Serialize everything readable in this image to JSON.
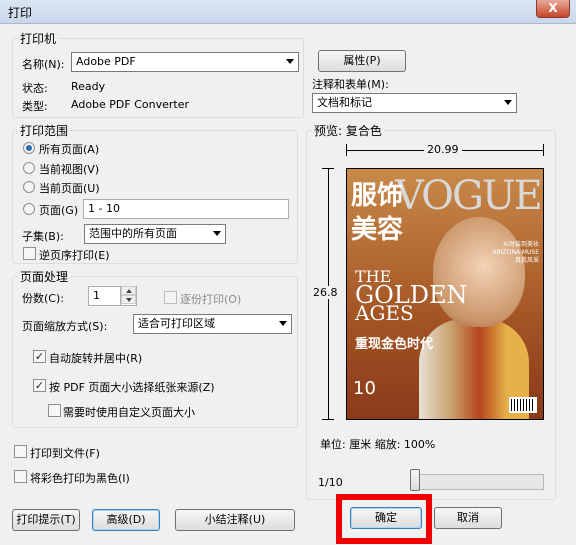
{
  "window": {
    "title": "打印",
    "close_label": "X"
  },
  "printer": {
    "group_title": "打印机",
    "name_label": "名称(N):",
    "name_value": "Adobe PDF",
    "properties_button": "属性(P)",
    "status_label": "状态:",
    "status_value": "Ready",
    "type_label": "类型:",
    "type_value": "Adobe PDF Converter",
    "comments_label": "注释和表单(M):",
    "comments_value": "文档和标记"
  },
  "range": {
    "group_title": "打印范围",
    "options": [
      "所有页面(A)",
      "当前视图(V)",
      "当前页面(U)",
      "页面(G)"
    ],
    "selected_index": 0,
    "pages_value": "1 - 10",
    "subset_label": "子集(B):",
    "subset_value": "范围中的所有页面",
    "reverse_label": "逆页序打印(E)"
  },
  "handling": {
    "group_title": "页面处理",
    "copies_label": "份数(C):",
    "copies_value": "1",
    "collate_label": "逐份打印(O)",
    "scaling_label": "页面缩放方式(S):",
    "scaling_value": "适合可打印区域",
    "auto_rotate_label": "自动旋转并居中(R)",
    "choose_source_label": "按 PDF 页面大小选择纸张来源(Z)",
    "custom_size_label": "需要时使用自定义页面大小"
  },
  "output": {
    "print_to_file_label": "打印到文件(F)",
    "grayscale_label": "将彩色打印为黑色(I)"
  },
  "preview": {
    "title": "预览: 复合色",
    "width_value": "20.99",
    "height_value": "26.8",
    "unit_line": "单位: 厘米 缩放: 100%",
    "page_indicator": "1/10",
    "page_fraction": 0.1,
    "cover": {
      "masthead": "VOGUE",
      "cn_line1": "服饰",
      "cn_line2": "美容",
      "the": "THE",
      "golden": "GOLDEN",
      "ages": "AGES",
      "subtitle": "重现金色时代",
      "issue": "10",
      "side_text": "从时装到美妆 ARIZONA MUSE 真我风采"
    }
  },
  "footer": {
    "tips_button": "打印提示(T)",
    "advanced_button": "高级(D)",
    "summarize_button": "小结注释(U)",
    "ok_button": "确定",
    "cancel_button": "取消"
  },
  "colors": {
    "highlight": "#ee0000",
    "accent": "#2d6bb0"
  }
}
